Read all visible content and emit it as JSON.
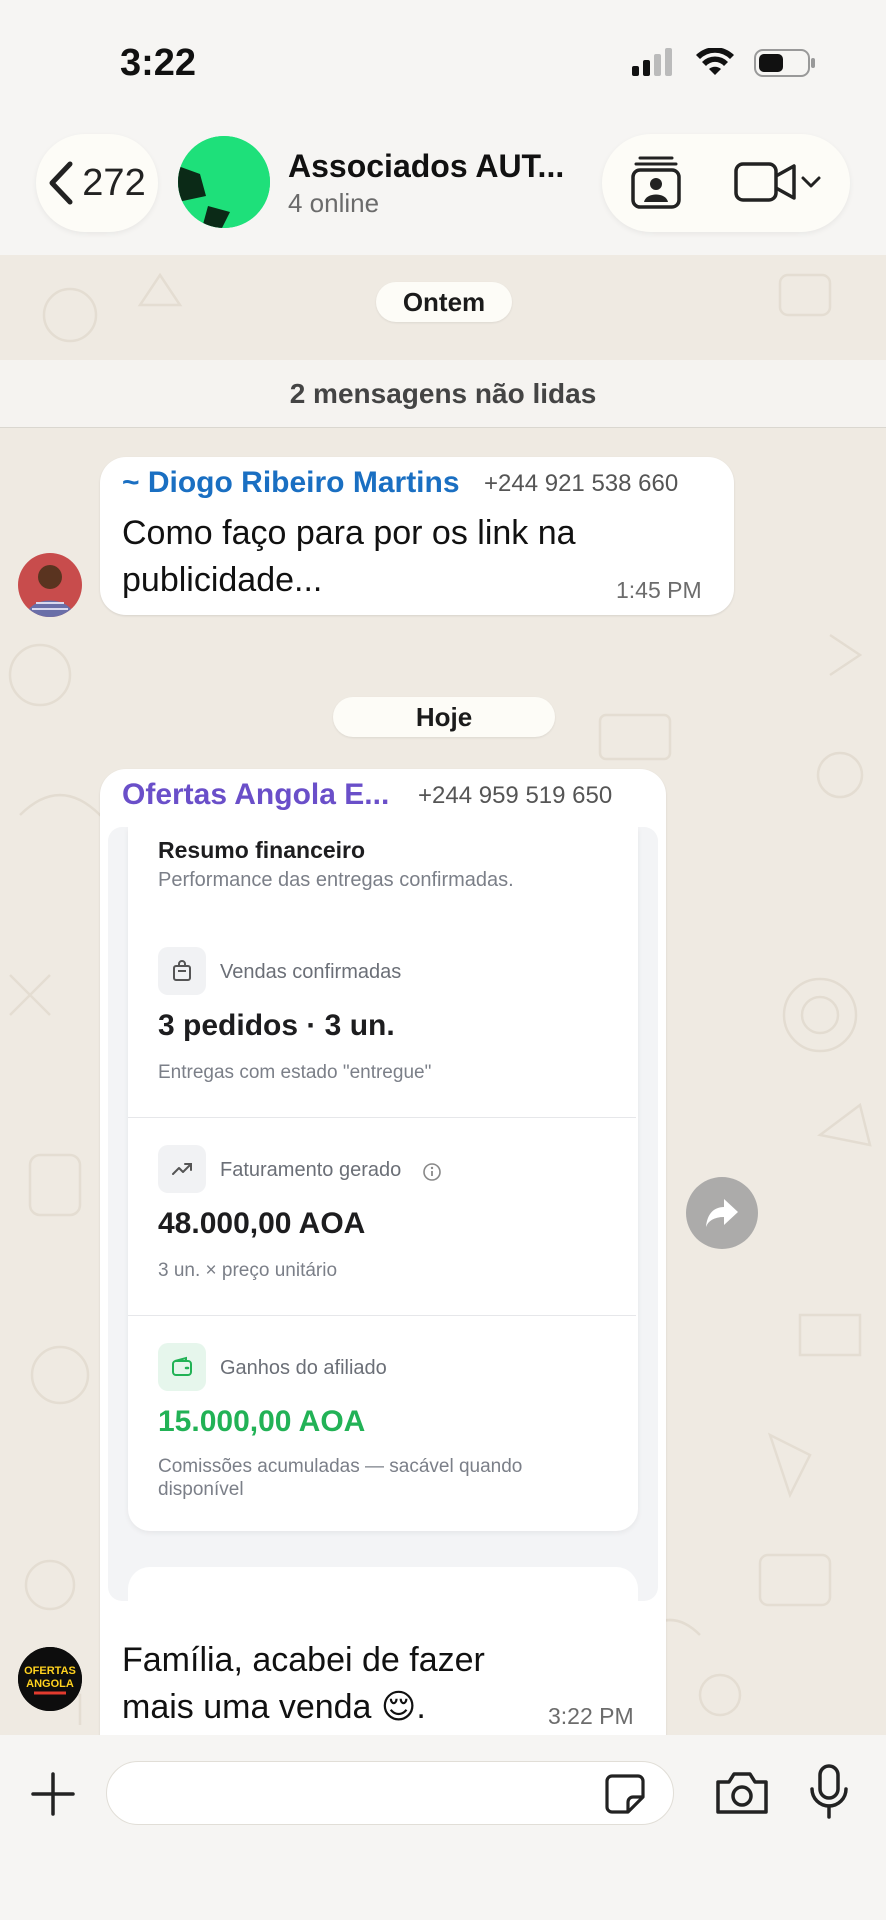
{
  "status_bar": {
    "time": "3:22"
  },
  "header": {
    "back_count": "272",
    "group_title": "Associados AUT...",
    "group_subtitle": "4 online"
  },
  "chat": {
    "date_yesterday": "Ontem",
    "unread_banner": "2 mensagens não lidas",
    "message1": {
      "sender_name": "~ Diogo Ribeiro Martins",
      "sender_phone": "+244 921 538 660",
      "text": "Como faço para por os link na publicidade...",
      "time": "1:45 PM"
    },
    "date_today": "Hoje",
    "message2": {
      "sender_name": "Ofertas Angola E...",
      "sender_phone": "+244 959 519 650",
      "text": "Família, acabei de fazer mais uma venda 😌.",
      "time": "3:22 PM",
      "image": {
        "title": "Resumo financeiro",
        "subtitle": "Performance das entregas confirmadas.",
        "stats": [
          {
            "label": "Vendas confirmadas",
            "value": "3 pedidos · 3 un.",
            "note": "Entregas com estado \"entregue\"",
            "icon": "bag-icon"
          },
          {
            "label": "Faturamento gerado",
            "value": "48.000,00 AOA",
            "note": "3 un. × preço unitário",
            "icon": "trend-up-icon"
          },
          {
            "label": "Ganhos do afiliado",
            "value": "15.000,00 AOA",
            "note": "Comissões acumuladas — sacável quando disponível",
            "icon": "wallet-icon"
          }
        ]
      }
    },
    "avatar2_text": [
      "OFERTAS",
      "ANGOLA"
    ]
  },
  "colors": {
    "sender1": "#1a6fc2",
    "sender2": "#6a4fc9",
    "earnings_green": "#22b256",
    "chat_background": "#efeae2"
  }
}
